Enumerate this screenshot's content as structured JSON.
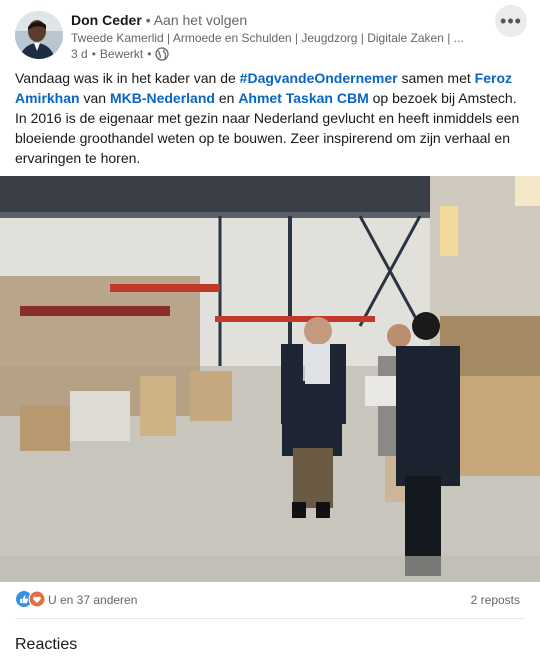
{
  "author": {
    "name": "Don Ceder",
    "follow_status": "Aan het volgen",
    "headline": "Tweede Kamerlid | Armoede en Schulden | Jeugdzorg | Digitale Zaken | ...",
    "age": "3 d",
    "edited": "Bewerkt",
    "visibility_icon": "globe-icon"
  },
  "post": {
    "t1": "Vandaag was ik in het kader van de ",
    "hashtag": "#DagvandeOndernemer",
    "t2": " samen met ",
    "mention1": "Feroz Amirkhan",
    "t3": " van ",
    "mention2": "MKB-Nederland",
    "t4": " en ",
    "mention3": "Ahmet Taskan CBM",
    "t5": " op bezoek bij Amstech. In 2016 is de eigenaar met gezin naar Nederland gevlucht en heeft inmiddels een bloeiende groothandel weten op te bouwen. Zeer inspirerend om zijn verhaal en ervaringen te horen."
  },
  "social": {
    "reactions": "U en 37 anderen",
    "reposts": "2 reposts",
    "reaction_icons": [
      "like-icon",
      "love-icon"
    ]
  },
  "comments_heading": "Reacties",
  "colors": {
    "link": "#0a66c2",
    "muted": "#666666",
    "text": "#191919"
  }
}
